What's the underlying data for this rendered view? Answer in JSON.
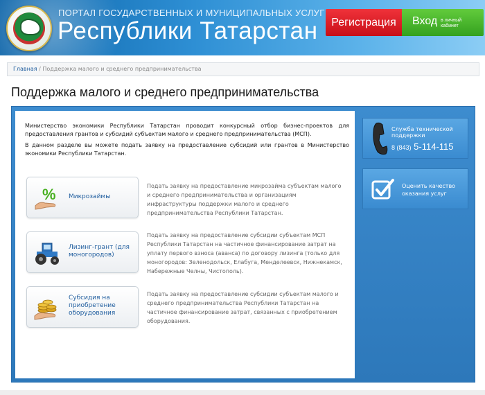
{
  "header": {
    "top_line": "ПОРТАЛ ГОСУДАРСТВЕННЫХ И МУНИЦИПАЛЬНЫХ УСЛУГ",
    "main_title": "Республики Татарстан",
    "register_label": "Регистрация",
    "login_label": "Вход",
    "login_sub": "в личный кабинет"
  },
  "breadcrumb": {
    "home": "Главная",
    "separator": " / ",
    "current": "Поддержка малого и среднего предпринимательства"
  },
  "page_title": "Поддержка малого и среднего предпринимательства",
  "intro": {
    "p1": "Министерство экономики Республики Татарстан проводит конкурсный отбор бизнес-проектов для предоставления грантов и субсидий субъектам малого и среднего предпринимательства (МСП).",
    "p2": "В данном разделе вы можете подать заявку на предоставление субсидий или грантов в Министерство экономики Республики Татарстан."
  },
  "services": [
    {
      "label": "Микрозаймы",
      "icon": "percent-hand-icon",
      "description": "Подать заявку на предоставление микрозайма субъектам малого и среднего предпринимательства и организациям инфраструктуры поддержки малого и среднего предпринимательства Республики Татарстан."
    },
    {
      "label": "Лизинг-грант (для моногородов)",
      "icon": "tractor-icon",
      "description": "Подать заявку на предоставление субсидии субъектам МСП Республики Татарстан на частичное финансирование затрат на уплату первого взноса (аванса) по договору лизинга (только для моногородов: Зеленодольск, Елабуга, Менделеевск, Нижнекамск, Набережные Челны, Чистополь)."
    },
    {
      "label": "Субсидия на приобретение оборудования",
      "icon": "coins-hand-icon",
      "description": "Подать заявку на предоставление субсидии субъектам малого и среднего предпринимательства Республики Татарстан на частичное финансирование затрат, связанных с приобретением оборудования."
    }
  ],
  "sidebar": {
    "support_title": "Служба технической поддержки",
    "support_code": "8 (843)",
    "support_number": "5-114-115",
    "quality_label": "Оценить качество оказания услуг"
  },
  "colors": {
    "header_blue": "#2e8fd4",
    "register_red": "#e0222a",
    "login_green": "#4db82d",
    "frame_blue": "#3380c2",
    "link_blue": "#1f5d9e"
  }
}
